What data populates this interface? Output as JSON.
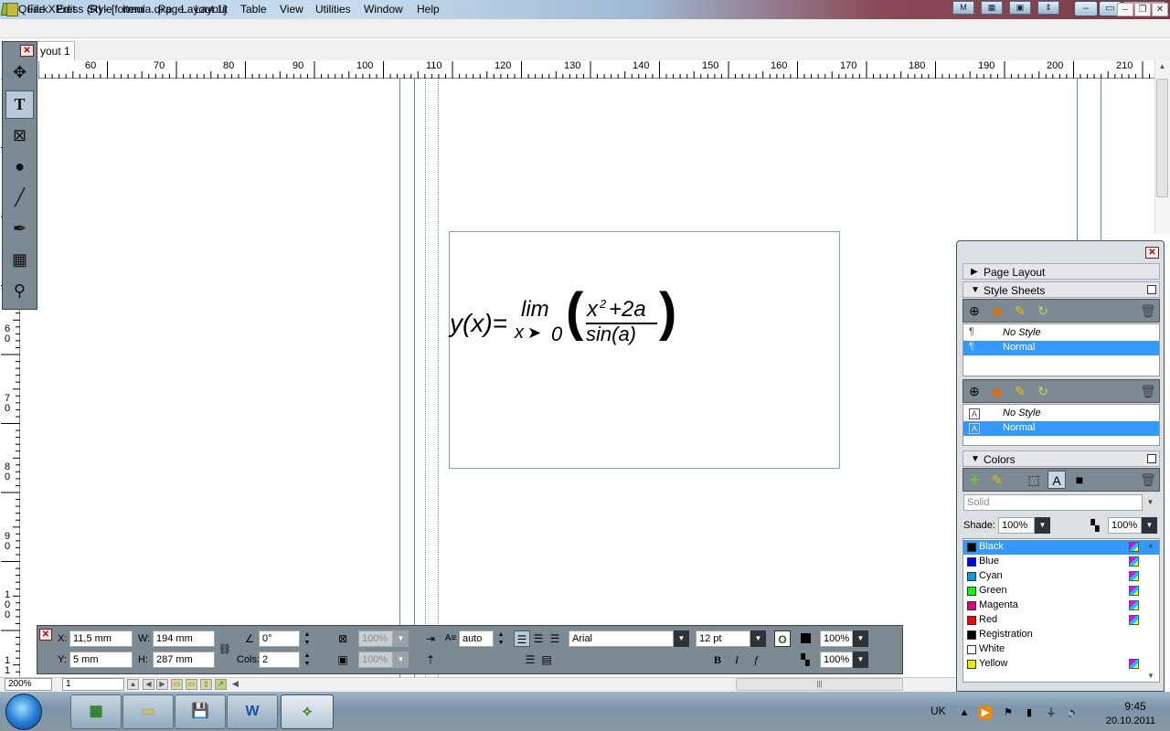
{
  "window": {
    "title": "QuarkXPress (R) - [formula.qxp : Layout 1]",
    "buttons": {
      "minimize": "–",
      "maximize": "▭",
      "close": "✕"
    }
  },
  "menu": [
    "File",
    "Edit",
    "Style",
    "Item",
    "Page",
    "Layout",
    "Table",
    "View",
    "Utilities",
    "Window",
    "Help"
  ],
  "tab": {
    "label": "yout 1"
  },
  "ruler": {
    "h_ticks": [
      "60",
      "70",
      "80",
      "90",
      "100",
      "110",
      "120",
      "130",
      "140",
      "150",
      "160",
      "170",
      "180",
      "190",
      "200",
      "210"
    ],
    "v_ticks": [
      "6\n0",
      "7\n0",
      "8\n0",
      "9\n0",
      "1\n0\n0",
      "1\n1"
    ]
  },
  "formula": {
    "lhs": "y(x)=",
    "op": "lim",
    "sub": "x",
    "arrow": "➤",
    "sub_to": "0",
    "lparen": "(",
    "rparen": ")",
    "num_base": "x",
    "num_exp": "2",
    "num_rest": "+2a",
    "den": "sin(a)"
  },
  "measurements": {
    "x_label": "X:",
    "x": "11,5 mm",
    "y_label": "Y:",
    "y": "5 mm",
    "w_label": "W:",
    "w": "194 mm",
    "h_label": "H:",
    "h": "287 mm",
    "angle": "0°",
    "cols_label": "Cols:",
    "cols": "2",
    "opacity1": "100%",
    "opacity2": "100%",
    "leading": "auto",
    "font": "Arial",
    "size": "12 pt",
    "shade1": "100%",
    "shade2": "100%"
  },
  "status": {
    "zoom": "200%",
    "page": "1"
  },
  "palette": {
    "page_layout": "Page Layout",
    "style_sheets": "Style Sheets",
    "para_styles": [
      "No Style",
      "Normal"
    ],
    "char_styles": [
      "No Style",
      "Normal"
    ],
    "colors_title": "Colors",
    "fill_type": "Solid",
    "shade_label": "Shade:",
    "shade": "100%",
    "opacity": "100%",
    "colors": [
      {
        "name": "Black",
        "hex": "#000000",
        "sel": true
      },
      {
        "name": "Blue",
        "hex": "#0000ff"
      },
      {
        "name": "Cyan",
        "hex": "#00a0e0"
      },
      {
        "name": "Green",
        "hex": "#00ff00"
      },
      {
        "name": "Magenta",
        "hex": "#e0007a"
      },
      {
        "name": "Red",
        "hex": "#ff0000"
      },
      {
        "name": "Registration",
        "hex": "#000000"
      },
      {
        "name": "White",
        "hex": "#ffffff"
      },
      {
        "name": "Yellow",
        "hex": "#e8f000"
      }
    ]
  },
  "taskbar": {
    "lang": "UK",
    "time": "9:45",
    "date": "20.10.2011"
  }
}
